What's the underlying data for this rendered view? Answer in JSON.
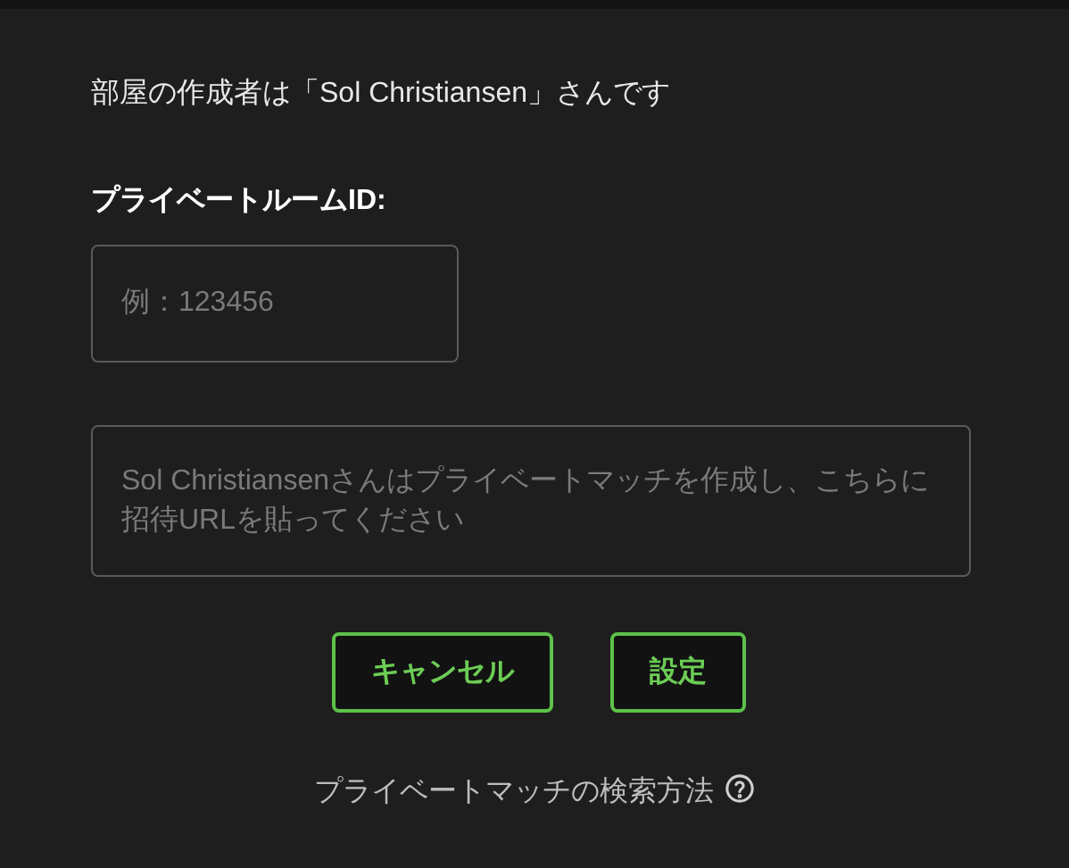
{
  "creator_notice": "部屋の作成者は「Sol Christiansen」さんです",
  "room_id": {
    "label": "プライベートルームID:",
    "placeholder": "例：123456"
  },
  "invite_url": {
    "placeholder": "Sol Christiansenさんはプライベートマッチを作成し、こちらに招待URLを貼ってください"
  },
  "buttons": [
    {
      "label": "キャンセル"
    },
    {
      "label": "設定"
    }
  ],
  "help_link": "プライベートマッチの検索方法"
}
